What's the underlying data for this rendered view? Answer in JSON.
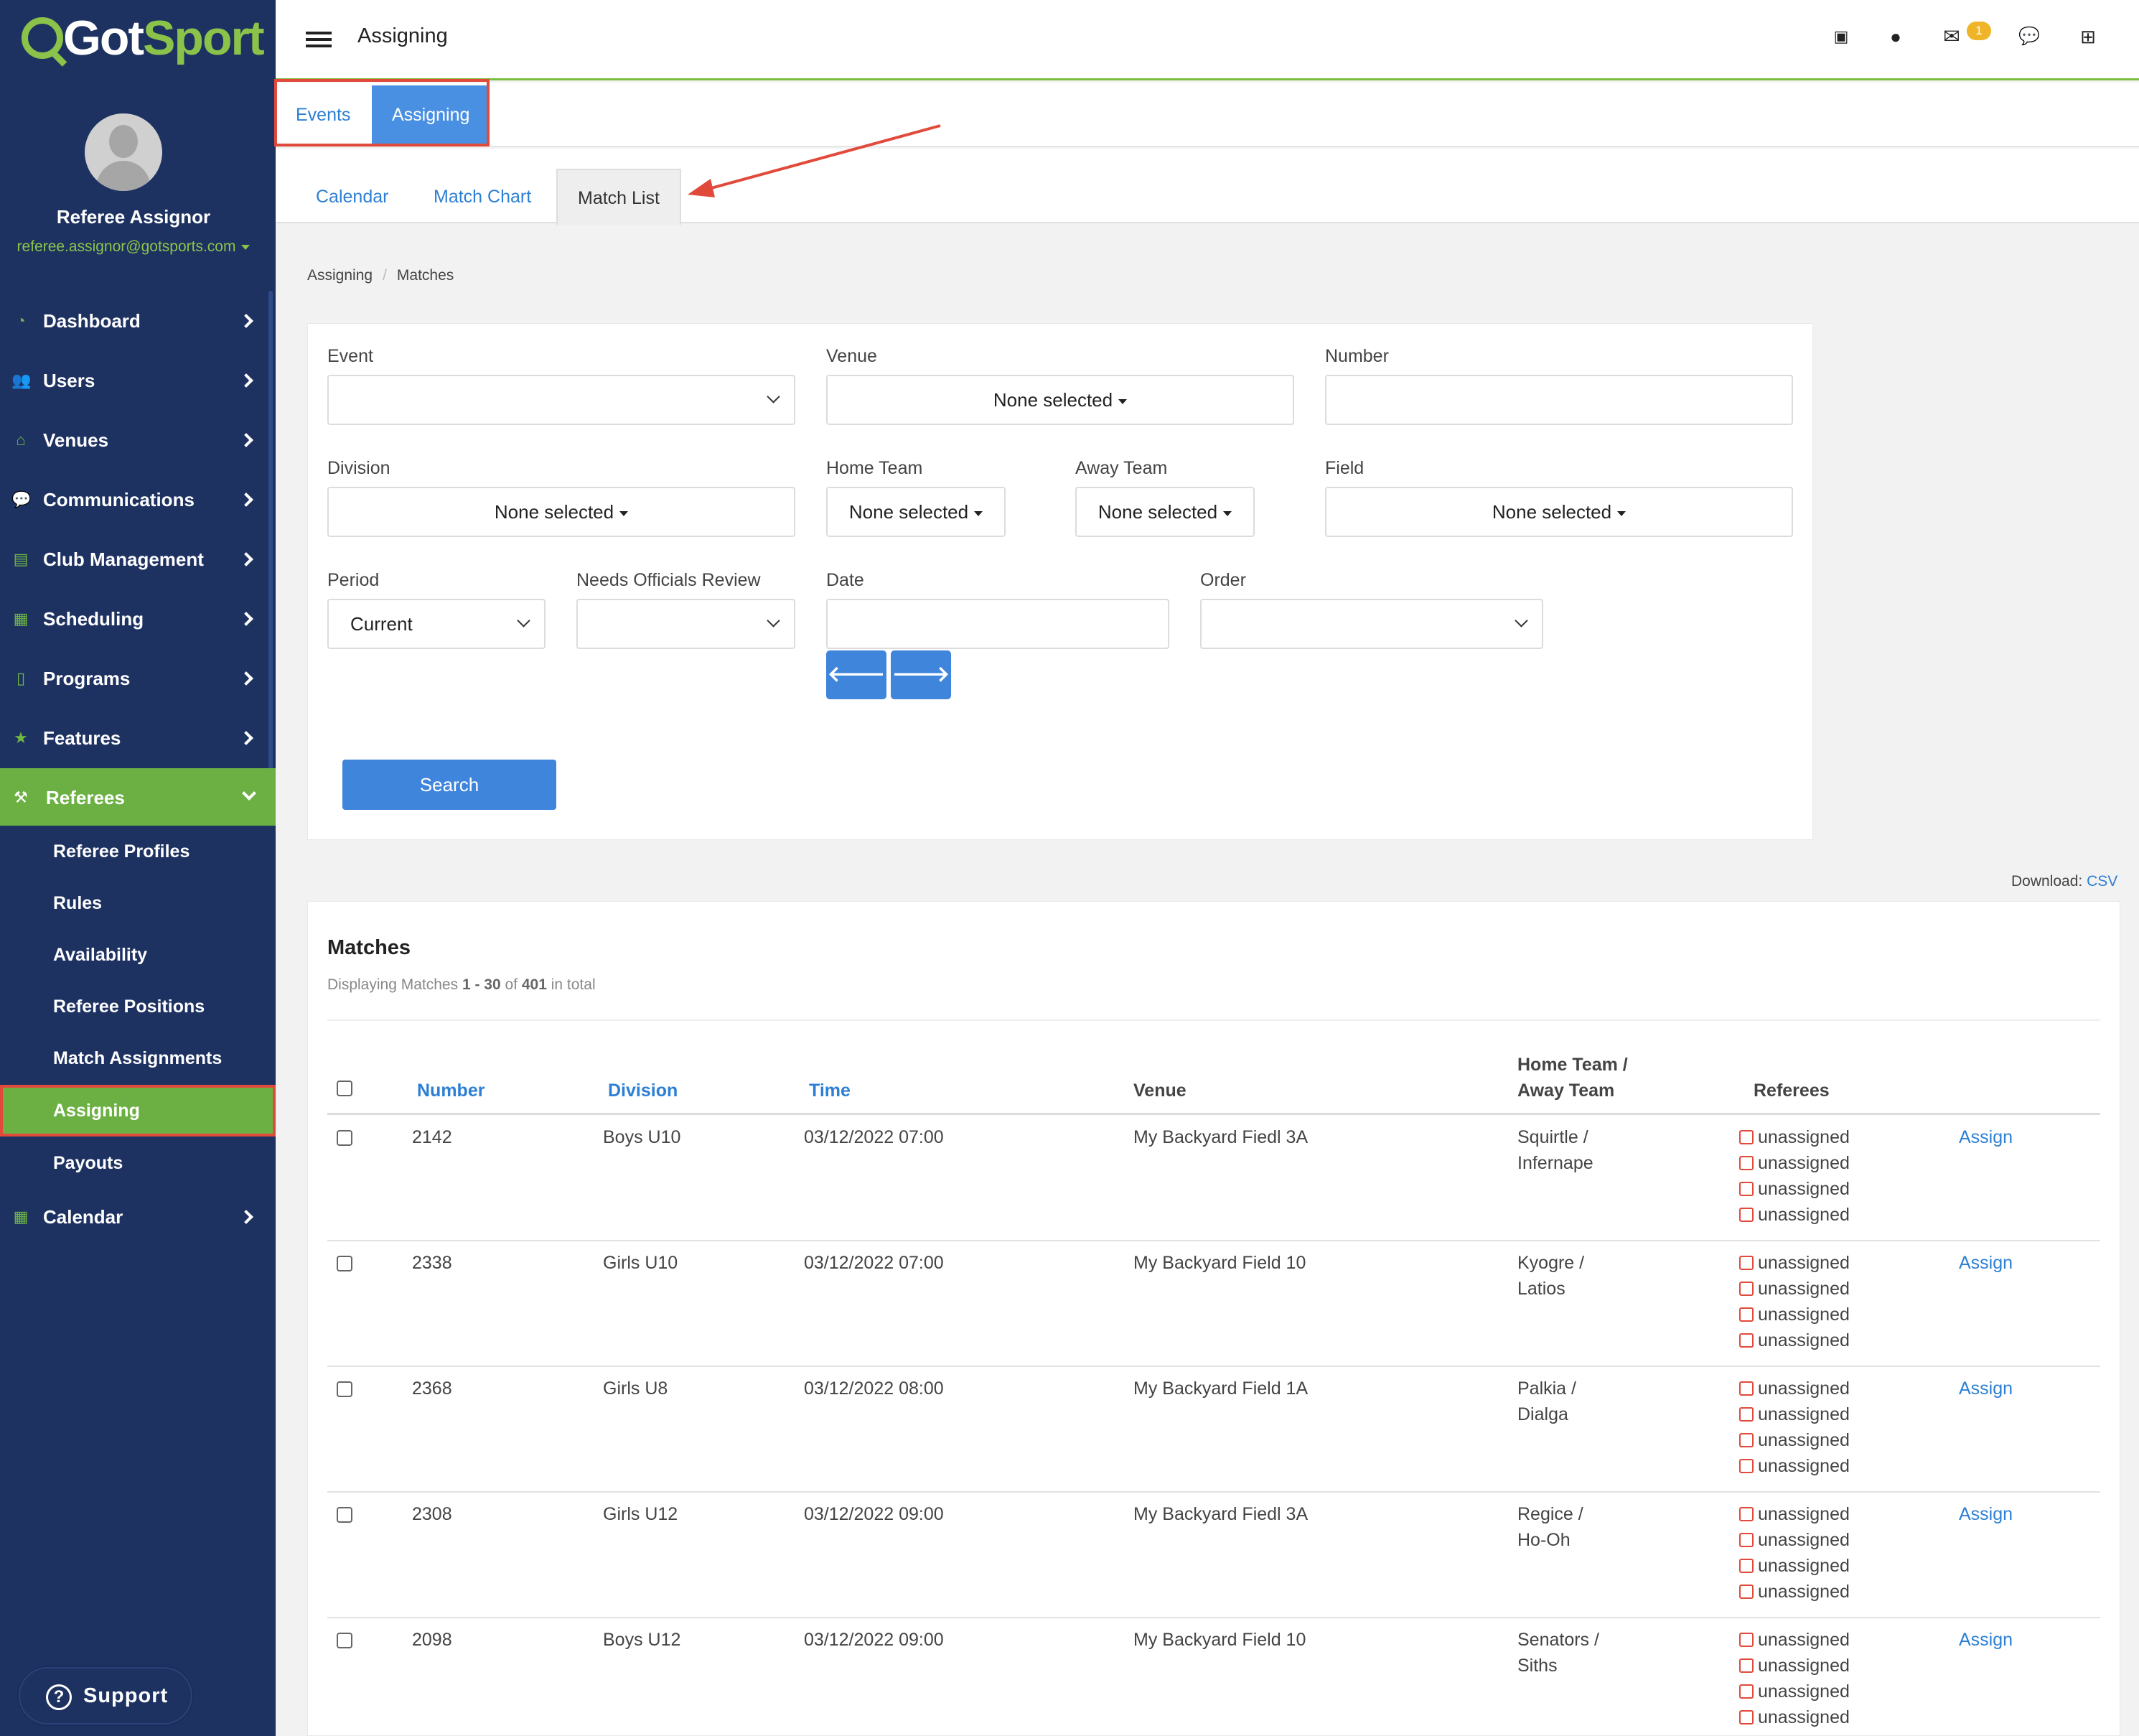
{
  "brand": {
    "logo_text_a": "Got",
    "logo_text_b": "Sport",
    "accent": "#6cb043",
    "sidebar_bg": "#1e3262",
    "link": "#2c7fd4"
  },
  "profile": {
    "name": "Referee Assignor",
    "email": "referee.assignor@gotsports.com"
  },
  "sidebar": {
    "items": [
      {
        "label": "Dashboard",
        "icon": "dashboard-icon"
      },
      {
        "label": "Users",
        "icon": "users-icon"
      },
      {
        "label": "Venues",
        "icon": "venues-icon"
      },
      {
        "label": "Communications",
        "icon": "chat-icon"
      },
      {
        "label": "Club Management",
        "icon": "club-icon"
      },
      {
        "label": "Scheduling",
        "icon": "scheduling-icon"
      },
      {
        "label": "Programs",
        "icon": "programs-icon"
      },
      {
        "label": "Features",
        "icon": "star-icon"
      },
      {
        "label": "Referees",
        "icon": "gavel-icon"
      },
      {
        "label": "Calendar",
        "icon": "calendar-icon"
      }
    ],
    "sub_items": [
      "Referee Profiles",
      "Rules",
      "Availability",
      "Referee Positions",
      "Match Assignments",
      "Assigning",
      "Payouts"
    ],
    "support": "Support"
  },
  "topbar": {
    "title": "Assigning",
    "mail_badge": "1"
  },
  "tabs_top": [
    "Events",
    "Assigning"
  ],
  "tabs_sub": [
    "Calendar",
    "Match Chart",
    "Match List"
  ],
  "breadcrumb": [
    "Assigning",
    "Matches"
  ],
  "filters": {
    "event": {
      "label": "Event",
      "value": ""
    },
    "venue": {
      "label": "Venue",
      "value": "None selected"
    },
    "number": {
      "label": "Number",
      "value": ""
    },
    "division": {
      "label": "Division",
      "value": "None selected"
    },
    "home_team": {
      "label": "Home Team",
      "value": "None selected"
    },
    "away_team": {
      "label": "Away Team",
      "value": "None selected"
    },
    "field": {
      "label": "Field",
      "value": "None selected"
    },
    "period": {
      "label": "Period",
      "value": "Current"
    },
    "needs_review": {
      "label": "Needs Officials Review",
      "value": ""
    },
    "date": {
      "label": "Date",
      "value": ""
    },
    "order": {
      "label": "Order",
      "value": ""
    },
    "search_label": "Search"
  },
  "download": {
    "label": "Download:",
    "csv": "CSV"
  },
  "matches": {
    "title": "Matches",
    "summary_prefix": "Displaying Matches",
    "summary_range": "1 - 30",
    "summary_of": "of",
    "summary_total": "401",
    "summary_suffix": "in total",
    "headers": {
      "number": "Number",
      "division": "Division",
      "time": "Time",
      "venue": "Venue",
      "teams_1": "Home Team /",
      "teams_2": "Away Team",
      "referees": "Referees"
    },
    "assign_label": "Assign",
    "rows": [
      {
        "number": "2142",
        "division": "Boys U10",
        "time": "03/12/2022 07:00",
        "venue": "My Backyard Fiedl 3A",
        "home": "Squirtle /",
        "away": "Infernape",
        "refs": [
          "unassigned",
          "unassigned",
          "unassigned",
          "unassigned"
        ]
      },
      {
        "number": "2338",
        "division": "Girls U10",
        "time": "03/12/2022 07:00",
        "venue": "My Backyard Field 10",
        "home": "Kyogre /",
        "away": "Latios",
        "refs": [
          "unassigned",
          "unassigned",
          "unassigned",
          "unassigned"
        ]
      },
      {
        "number": "2368",
        "division": "Girls U8",
        "time": "03/12/2022 08:00",
        "venue": "My Backyard Field 1A",
        "home": "Palkia /",
        "away": "Dialga",
        "refs": [
          "unassigned",
          "unassigned",
          "unassigned",
          "unassigned"
        ]
      },
      {
        "number": "2308",
        "division": "Girls U12",
        "time": "03/12/2022 09:00",
        "venue": "My Backyard Fiedl 3A",
        "home": "Regice /",
        "away": "Ho-Oh",
        "refs": [
          "unassigned",
          "unassigned",
          "unassigned",
          "unassigned"
        ]
      },
      {
        "number": "2098",
        "division": "Boys U12",
        "time": "03/12/2022 09:00",
        "venue": "My Backyard Field 10",
        "home": "Senators /",
        "away": "Siths",
        "refs": [
          "unassigned",
          "unassigned",
          "unassigned",
          "unassigned"
        ]
      }
    ]
  }
}
